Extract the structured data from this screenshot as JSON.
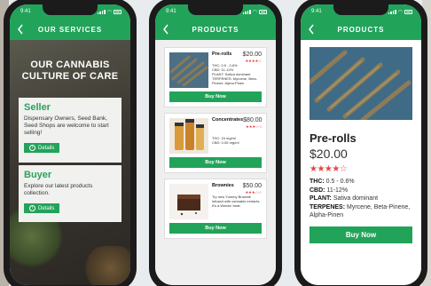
{
  "status": {
    "time": "9:41"
  },
  "phone1": {
    "title": "OUR SERVICES",
    "hero": "OUR CANNABIS\nCULTURE OF CARE",
    "cards": [
      {
        "heading": "Seller",
        "text": "Dispensary Owners, Seed Bank, Seed Shops are welcome to start selling!",
        "button": "Details"
      },
      {
        "heading": "Buyer",
        "text": "Explore our latest products collection.",
        "button": "Details"
      }
    ]
  },
  "phone2": {
    "title": "PRODUCTS",
    "products": [
      {
        "name": "Pre-rolls",
        "price": "$20.00",
        "specs": [
          "THC: 0.5 - 0.6%",
          "CBD: 11-12%",
          "PLANT: Sativa dominant",
          "TERPENES: Myrcene, Beta-Pinene, Alpha-Pinen"
        ],
        "button": "Buy Now",
        "rating": 4
      },
      {
        "name": "Concentrates",
        "price": "$80.00",
        "specs": [
          "THC: 15 mg/ml",
          "CBD: 0.05 mg/ml"
        ],
        "button": "Buy Now",
        "rating": 3
      },
      {
        "name": "Brownies",
        "price": "$50.00",
        "specs": [
          "Try new Yummy Brownie infused with cannabis extracts. It's a Weeks' treat."
        ],
        "button": "Buy Now",
        "rating": 3
      }
    ]
  },
  "phone3": {
    "title": "PRODUCTS",
    "name": "Pre-rolls",
    "price": "$20.00",
    "rating": 4,
    "specs": [
      {
        "label": "THC:",
        "value": " 0.5 - 0.6%"
      },
      {
        "label": "CBD:",
        "value": " 11-12%"
      },
      {
        "label": "PLANT:",
        "value": " Sativa dominant"
      },
      {
        "label": "TERPENES:",
        "value": " Myrcene, Beta-Pinene, Alpha-Pinen"
      }
    ],
    "button": "Buy Now"
  },
  "colors": {
    "accent": "#22a35a",
    "star": "#e84545"
  }
}
